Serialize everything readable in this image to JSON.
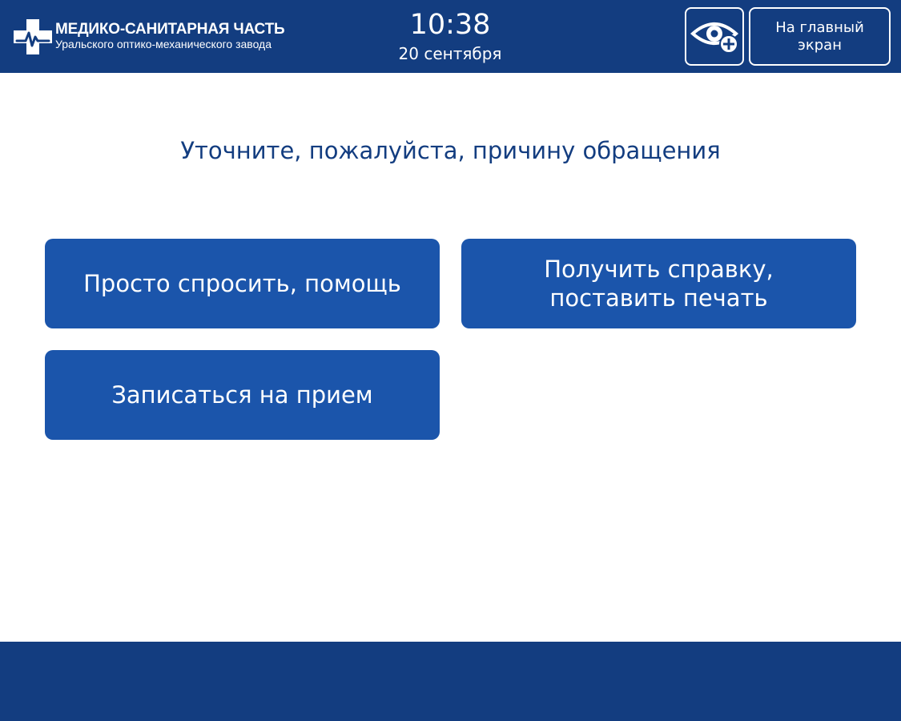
{
  "header": {
    "org_title": "МЕДИКО-САНИТАРНАЯ ЧАСТЬ",
    "org_subtitle": "Уральского оптико-механического завода",
    "time": "10:38",
    "date": "20 сентября",
    "vision_button_icon": "eye-plus-icon",
    "home_button_label": "На главный экран",
    "logo_icon": "medical-cross-icon",
    "background_color": "#133d80"
  },
  "main": {
    "prompt": "Уточните, пожалуйста, причину обращения",
    "options": [
      {
        "label": "Просто спросить, помощь"
      },
      {
        "label": "Получить справку, поставить печать"
      },
      {
        "label": "Записаться на прием"
      }
    ],
    "button_color": "#1b55ab"
  }
}
